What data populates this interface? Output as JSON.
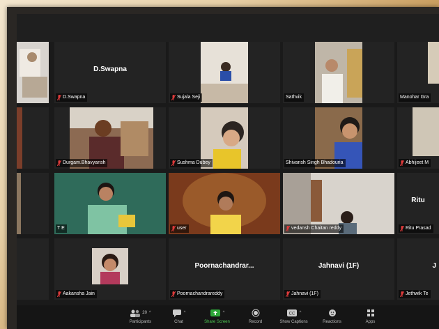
{
  "tiles": {
    "r1c2": {
      "center": "D.Swapna",
      "label": "D.Swapna"
    },
    "r1c3": {
      "label": "Sujala Seji"
    },
    "r1c4": {
      "label": "Sathvik"
    },
    "r1c5": {
      "label": "Manohar Gra"
    },
    "r2c2": {
      "label": "Durgam.Bhavyansh"
    },
    "r2c3": {
      "label": "Sushma Dubey"
    },
    "r2c4": {
      "label": "Shivansh Singh Bhadouria"
    },
    "r2c5": {
      "label": "Abhijeet M"
    },
    "r3c2": {
      "label": "T E"
    },
    "r3c3": {
      "label": "user"
    },
    "r3c4": {
      "label": "vedansh Chaitan reddy"
    },
    "r3c5": {
      "center": "Ritu",
      "label": "Ritu Prasad"
    },
    "r4c2": {
      "label": "Aakansha Jain"
    },
    "r4c3": {
      "center": "Poornachandrar...",
      "label": "Poornachandrareddy"
    },
    "r4c4": {
      "center": "Jahnavi (1F)",
      "label": "Jahnavi (1F)"
    },
    "r4c5": {
      "center": "J",
      "label": "Jethwik Te"
    }
  },
  "toolbar": {
    "participants_label": "Participants",
    "participants_count": "20",
    "chat_label": "Chat",
    "share_label": "Share Screen",
    "record_label": "Record",
    "captions_label": "Show Captions",
    "captions_icon_text": "CC",
    "reactions_label": "Reactions",
    "apps_label": "Apps"
  },
  "colors": {
    "active_speaker": "#d9f21a",
    "share_green": "#4ecb53",
    "mic_muted": "#e03b3b"
  }
}
